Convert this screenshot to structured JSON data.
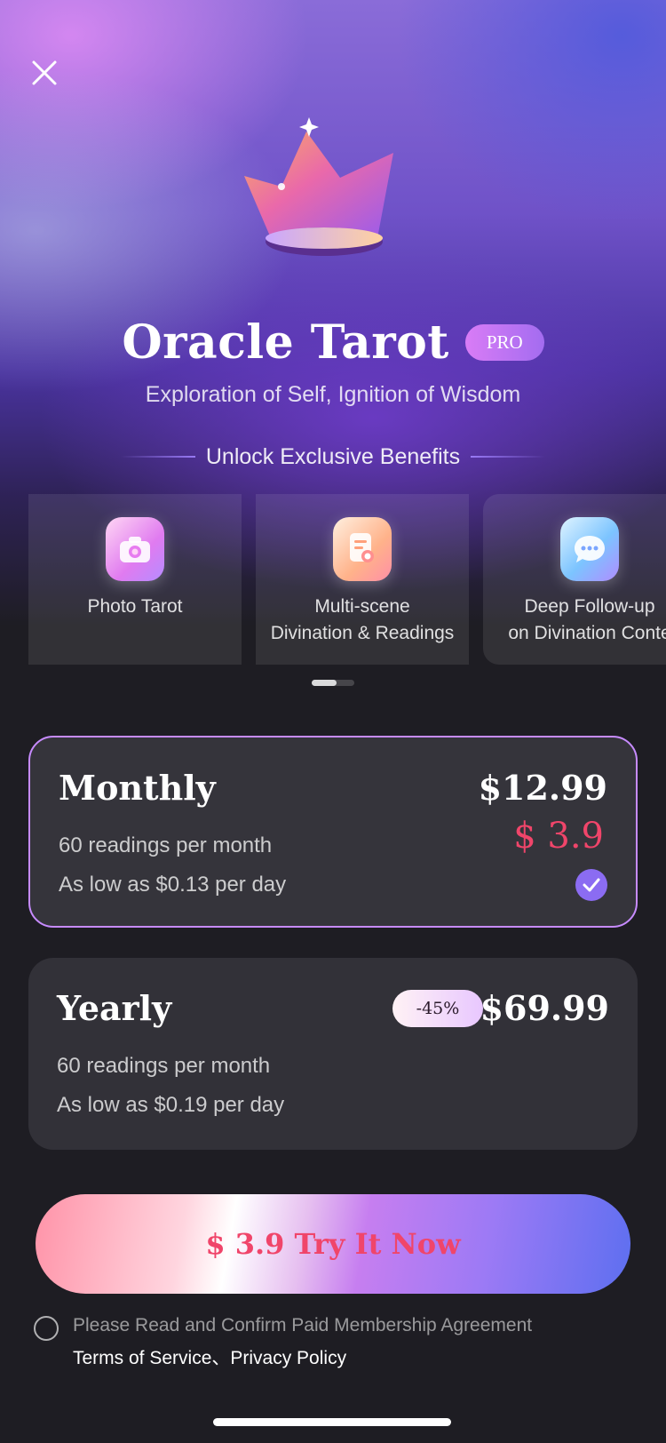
{
  "header": {
    "close_icon": "close-icon",
    "app_title": "Oracle Tarot",
    "pro_badge": "PRO",
    "subtitle": "Exploration of Self, Ignition of Wisdom"
  },
  "benefits": {
    "heading": "Unlock Exclusive Benefits",
    "items": [
      {
        "label": "Photo Tarot",
        "icon": "camera-icon"
      },
      {
        "label": "Multi-scene\nDivination & Readings",
        "icon": "document-search-icon"
      },
      {
        "label": "Deep Follow-up\non Divination Conte",
        "icon": "chat-bubble-icon"
      }
    ],
    "page_count": 2,
    "current_page": 1
  },
  "plans": [
    {
      "name": "Monthly",
      "price": "$12.99",
      "sale_price": "$ 3.9",
      "line1": "60 readings per month",
      "line2": "As low as $0.13 per day",
      "selected": true
    },
    {
      "name": "Yearly",
      "discount": "-45%",
      "price": "$69.99",
      "line1": "60 readings per month",
      "line2": "As low as $0.19 per day",
      "selected": false
    }
  ],
  "cta": {
    "label": "$ 3.9 Try It Now"
  },
  "agreement": {
    "text": "Please Read and Confirm Paid Membership Agreement",
    "terms": "Terms of Service",
    "separator": "、",
    "privacy": "Privacy Policy",
    "checked": false
  },
  "colors": {
    "accent_purple": "#8b6cf2",
    "sale_red": "#f0456a",
    "selected_border": "#c78bff",
    "card_bg": "#323138",
    "page_bg": "#1e1d23"
  }
}
